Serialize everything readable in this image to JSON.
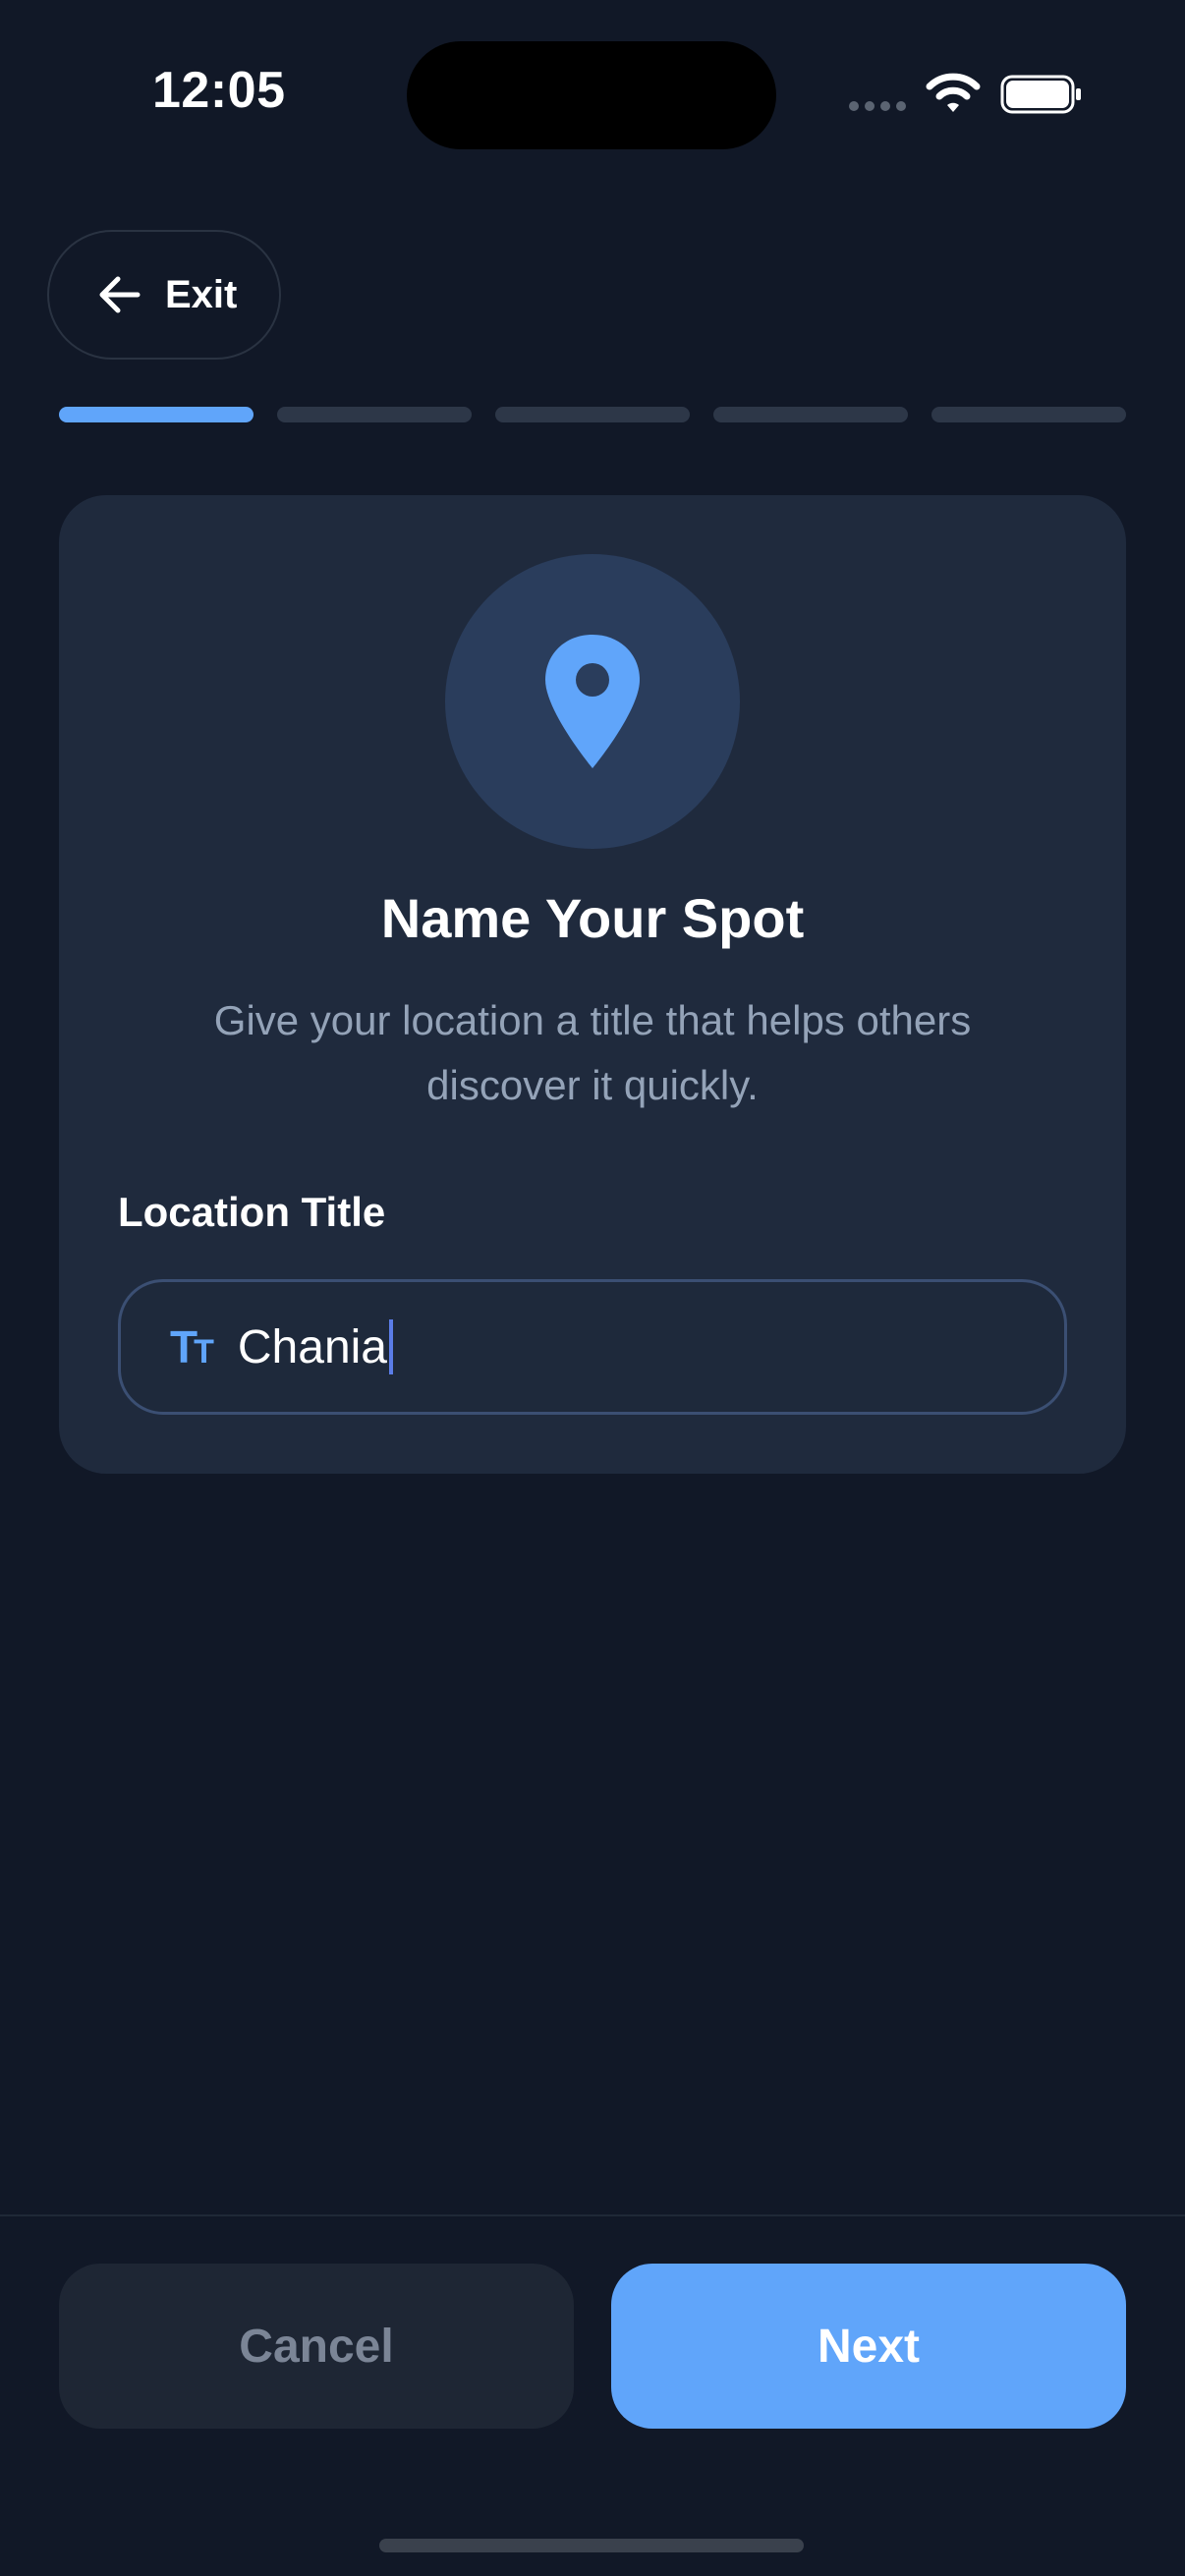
{
  "status_bar": {
    "time": "12:05"
  },
  "nav": {
    "exit_label": "Exit"
  },
  "progress": {
    "current_step": 1,
    "total_steps": 5
  },
  "card": {
    "icon": "map-pin-icon",
    "title": "Name Your Spot",
    "description": "Give your location a title that helps others discover it quickly.",
    "field_label": "Location Title",
    "input_icon": "text-size-icon",
    "input_value": "Chania"
  },
  "footer": {
    "cancel_label": "Cancel",
    "next_label": "Next"
  },
  "colors": {
    "background": "#111827",
    "card": "#1f2a3d",
    "accent": "#60a5fa",
    "muted_text": "#94a3b8"
  }
}
